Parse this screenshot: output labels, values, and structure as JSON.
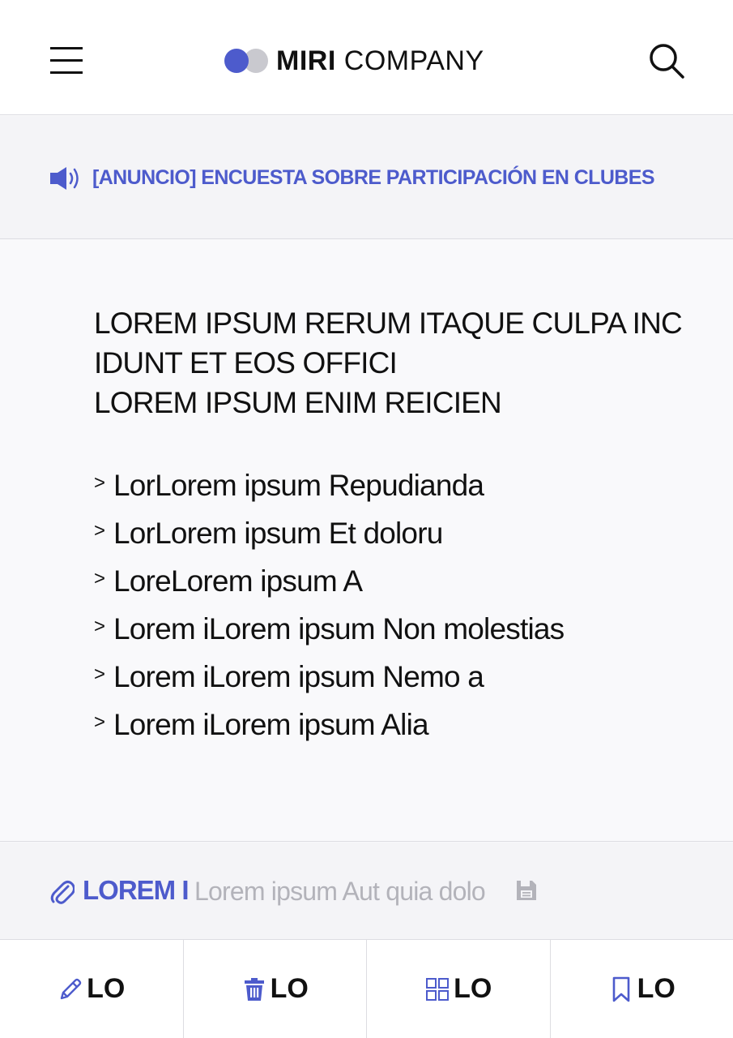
{
  "header": {
    "logo_bold": "MIRI",
    "logo_light": "COMPANY",
    "menu_icon": "hamburger-icon",
    "search_icon": "search-icon"
  },
  "notice": {
    "icon": "megaphone-icon",
    "text": "[ANUNCIO] ENCUESTA SOBRE PARTICIPACIÓN EN CLUBES"
  },
  "content": {
    "heading_lines": [
      "LOREM IPSUM RERUM ITAQUE CULPA INC",
      "IDUNT ET EOS OFFICI",
      "LOREM IPSUM ENIM REICIEN"
    ],
    "links": [
      {
        "label": "LorLorem ipsum Repudianda"
      },
      {
        "label": "LorLorem ipsum Et doloru"
      },
      {
        "label": "LoreLorem ipsum A"
      },
      {
        "label": "Lorem iLorem ipsum Non molestias"
      },
      {
        "label": "Lorem iLorem ipsum Nemo a"
      },
      {
        "label": "Lorem iLorem ipsum Alia"
      }
    ],
    "chevron": ">"
  },
  "attachment": {
    "title": "LOREM I",
    "file": "Lorem ipsum Aut quia dolo",
    "icon": "paperclip-icon",
    "save_icon": "floppy-disk-icon"
  },
  "bottom_bar": [
    {
      "label": "LO",
      "icon": "pencil-icon"
    },
    {
      "label": "LO",
      "icon": "trash-icon"
    },
    {
      "label": "LO",
      "icon": "grid-icon"
    },
    {
      "label": "LO",
      "icon": "bookmark-icon"
    }
  ],
  "colors": {
    "accent": "#4d5bcc",
    "muted": "#b3b3ba",
    "logo_gray": "#c9c9cf"
  }
}
